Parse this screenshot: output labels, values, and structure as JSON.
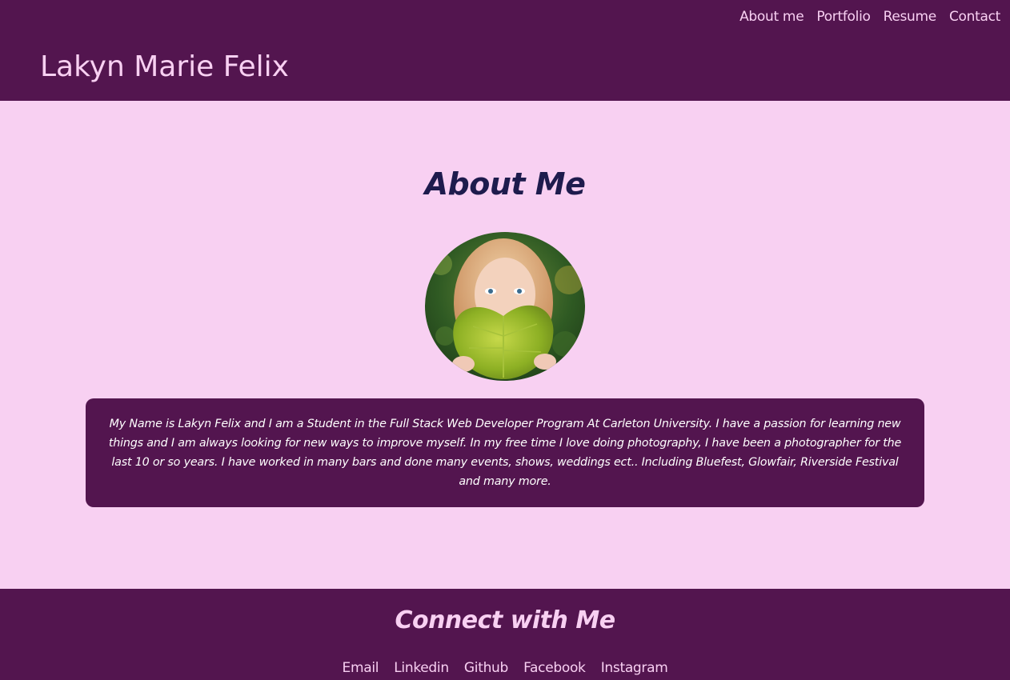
{
  "header": {
    "site_title": "Lakyn Marie Felix",
    "nav": [
      "About me",
      "Portfolio",
      "Resume",
      "Contact"
    ]
  },
  "main": {
    "heading": "About Me",
    "portrait_alt": "portrait-photo",
    "bio": "My Name is Lakyn Felix and I am a Student in the Full Stack Web Developer Program At Carleton University. I have a passion for learning new things and I am always looking for new ways to improve myself. In my free time I love doing photography, I have been a photographer for the last 10 or so years. I have worked in many bars and done many events, shows, weddings ect.. Including Bluefest, Glowfair, Riverside Festival and many more."
  },
  "footer": {
    "heading": "Connect with Me",
    "links": [
      "Email",
      "Linkedin",
      "Github",
      "Facebook",
      "Instagram"
    ]
  },
  "colors": {
    "header_bg": "#53154f",
    "page_bg": "#f8d0f2",
    "heading_text": "#1e1b4d",
    "light_text": "#f8d0f2"
  }
}
